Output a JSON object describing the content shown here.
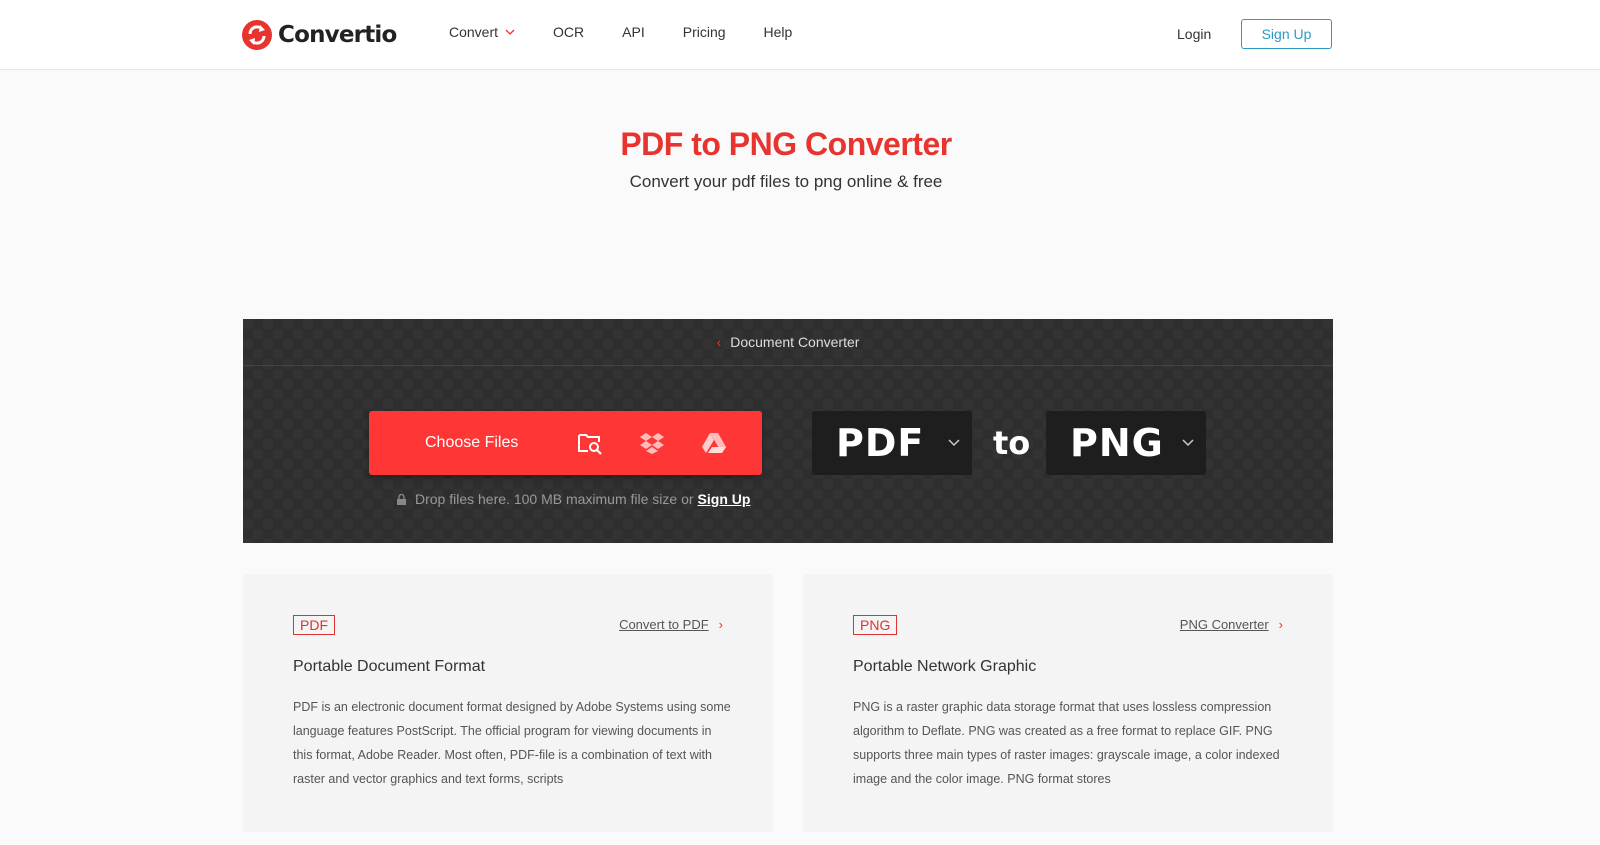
{
  "brand": {
    "name": "Convertio",
    "accent": "#e8342f",
    "link_color": "#2a9bc4"
  },
  "nav": {
    "items": [
      {
        "label": "Convert",
        "has_dropdown": true
      },
      {
        "label": "OCR"
      },
      {
        "label": "API"
      },
      {
        "label": "Pricing"
      },
      {
        "label": "Help"
      }
    ],
    "login": "Login",
    "signup": "Sign Up"
  },
  "hero": {
    "title": "PDF to PNG Converter",
    "subtitle": "Convert your pdf files to png online & free"
  },
  "converter": {
    "breadcrumb": "Document Converter",
    "choose_files": "Choose Files",
    "sources": [
      "folder-search-icon",
      "dropbox-icon",
      "google-drive-icon"
    ],
    "hint": "Drop files here. 100 MB maximum file size or",
    "hint_link": "Sign Up",
    "from_format": "PDF",
    "to_label": "to",
    "to_format": "PNG"
  },
  "cards": [
    {
      "badge": "PDF",
      "link": "Convert to PDF",
      "title": "Portable Document Format",
      "description": "PDF is an electronic document format designed by Adobe Systems using some language features PostScript. The official program for viewing documents in this format, Adobe Reader. Most often, PDF-file is a combination of text with raster and vector graphics and text forms, scripts"
    },
    {
      "badge": "PNG",
      "link": "PNG Converter",
      "title": "Portable Network Graphic",
      "description": "PNG is a raster graphic data storage format that uses lossless compression algorithm to Deflate. PNG was created as a free format to replace GIF. PNG supports three main types of raster images: grayscale image, a color indexed image and the color image. PNG format stores"
    }
  ]
}
